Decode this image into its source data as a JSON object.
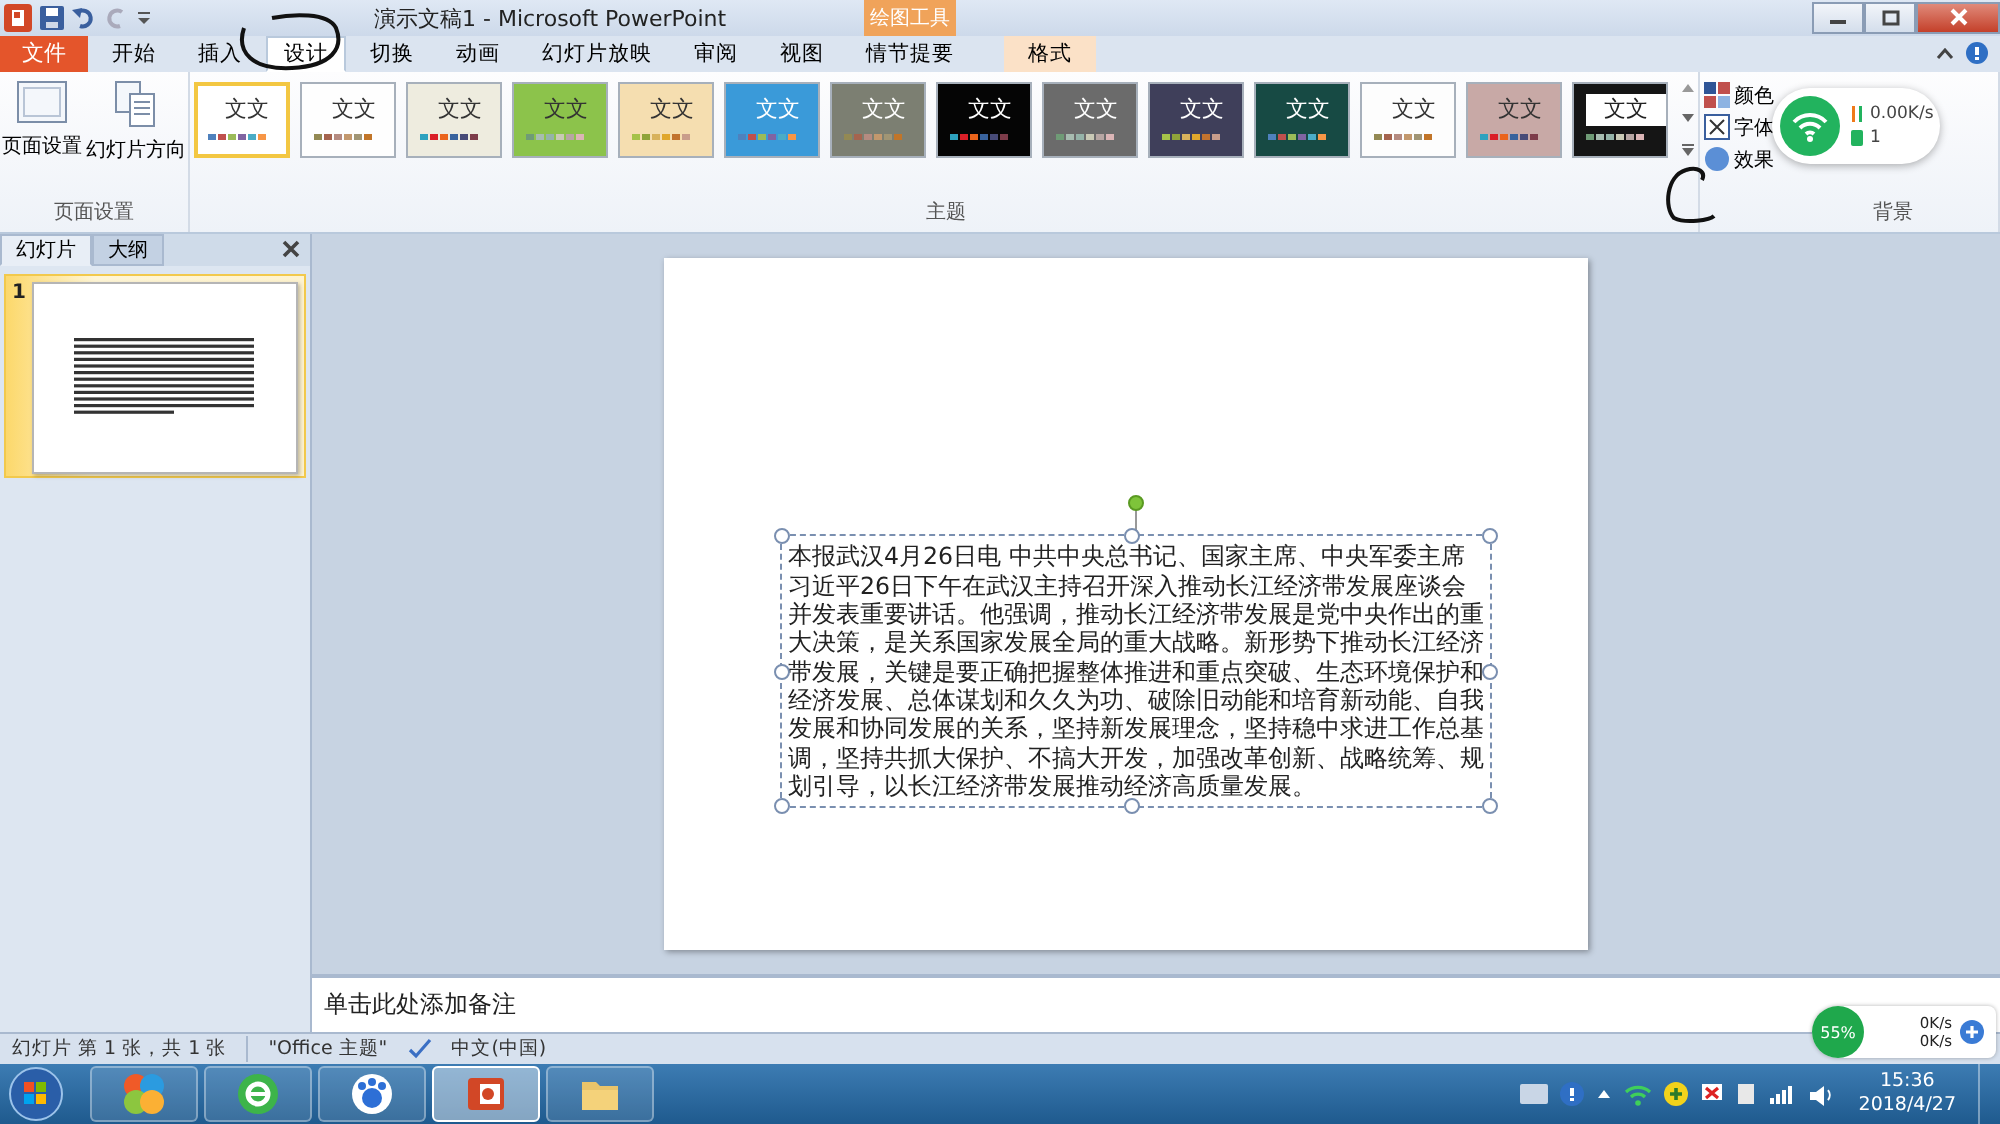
{
  "title_bar": {
    "title": "演示文稿1 - Microsoft PowerPoint",
    "context_group": "绘图工具"
  },
  "ribbon_tabs": [
    {
      "label": "文件",
      "kind": "file",
      "selected": false
    },
    {
      "label": "开始",
      "kind": "tab",
      "selected": false
    },
    {
      "label": "插入",
      "kind": "tab",
      "selected": false
    },
    {
      "label": "设计",
      "kind": "tab",
      "selected": true
    },
    {
      "label": "切换",
      "kind": "tab",
      "selected": false
    },
    {
      "label": "动画",
      "kind": "tab",
      "selected": false
    },
    {
      "label": "幻灯片放映",
      "kind": "tab",
      "selected": false
    },
    {
      "label": "审阅",
      "kind": "tab",
      "selected": false
    },
    {
      "label": "视图",
      "kind": "tab",
      "selected": false
    },
    {
      "label": "情节提要",
      "kind": "tab",
      "selected": false
    },
    {
      "label": "格式",
      "kind": "context",
      "selected": false
    }
  ],
  "ribbon": {
    "page_setup": {
      "buttons": [
        {
          "label": "页面设置",
          "kind": "page"
        },
        {
          "label": "幻灯片方向",
          "kind": "orient"
        }
      ],
      "group_label": "页面设置"
    },
    "themes": {
      "group_label": "主题",
      "items": [
        {
          "label": "文文",
          "kind": "plain",
          "selected": true,
          "color": "#ffffff"
        },
        {
          "label": "文文",
          "kind": "plain",
          "selected": false,
          "color": "#fefefe"
        },
        {
          "label": "文文",
          "kind": "plain",
          "selected": false,
          "color": "#eeecdf"
        },
        {
          "label": "文文",
          "kind": "plain",
          "selected": false,
          "color": "#8cc34b"
        },
        {
          "label": "文文",
          "kind": "plain",
          "selected": false,
          "color": "#f5deb0"
        },
        {
          "label": "文文",
          "kind": "plain",
          "selected": false,
          "color": "#3a9ad9"
        },
        {
          "label": "文文",
          "kind": "plain",
          "selected": false,
          "color": "#7c7f72"
        },
        {
          "label": "文文",
          "kind": "plain",
          "selected": false,
          "color": "#050505"
        },
        {
          "label": "文文",
          "kind": "plain",
          "selected": false,
          "color": "#6b6b6b"
        },
        {
          "label": "文文",
          "kind": "plain",
          "selected": false,
          "color": "#3f3f5a"
        },
        {
          "label": "文文",
          "kind": "plain",
          "selected": false,
          "color": "#174a44"
        },
        {
          "label": "文文",
          "kind": "plain",
          "selected": false,
          "color": "#fdfdfd"
        },
        {
          "label": "文文",
          "kind": "plain",
          "selected": false,
          "color": "#c8a9a6"
        },
        {
          "label": "文文",
          "kind": "boxed",
          "selected": false,
          "color": "#151515"
        }
      ]
    },
    "theme_options": [
      {
        "label": "颜色",
        "kind": "colors"
      },
      {
        "label": "字体",
        "kind": "fonts"
      },
      {
        "label": "效果",
        "kind": "effects"
      }
    ],
    "background": {
      "group_label": "背景"
    }
  },
  "network_popup": {
    "speed": "0.00K/s",
    "count": "1"
  },
  "slides_panel": {
    "tabs": [
      {
        "label": "幻灯片",
        "selected": true
      },
      {
        "label": "大纲",
        "selected": false
      }
    ],
    "thumbnails": [
      {
        "number": "1",
        "selected": true
      }
    ]
  },
  "slide": {
    "text": "本报武汉4月26日电 中共中央总书记、国家主席、中央军委主席习近平26日下午在武汉主持召开深入推动长江经济带发展座谈会并发表重要讲话。他强调，推动长江经济带发展是党中央作出的重大决策，是关系国家发展全局的重大战略。新形势下推动长江经济带发展，关键是要正确把握整体推进和重点突破、生态环境保护和经济发展、总体谋划和久久为功、破除旧动能和培育新动能、自我发展和协同发展的关系，坚持新发展理念，坚持稳中求进工作总基调，坚持共抓大保护、不搞大开发，加强改革创新、战略统筹、规划引导，以长江经济带发展推动经济高质量发展。"
  },
  "notes": {
    "prompt": "单击此处添加备注"
  },
  "status_bar": {
    "slide_info": "幻灯片 第 1 张，共 1 张",
    "theme": "\"Office 主题\"",
    "language": "中文(中国)"
  },
  "net_monitor": {
    "percent": "55%",
    "upload": "0K/s",
    "download": "0K/s"
  },
  "taskbar": {
    "apps": [
      {
        "kind": "pinwheel",
        "selected": false
      },
      {
        "kind": "browser",
        "selected": false
      },
      {
        "kind": "paw",
        "selected": false
      },
      {
        "kind": "slides",
        "selected": true
      },
      {
        "kind": "folder",
        "selected": false
      }
    ],
    "time": "15:36",
    "date": "2018/4/27"
  }
}
